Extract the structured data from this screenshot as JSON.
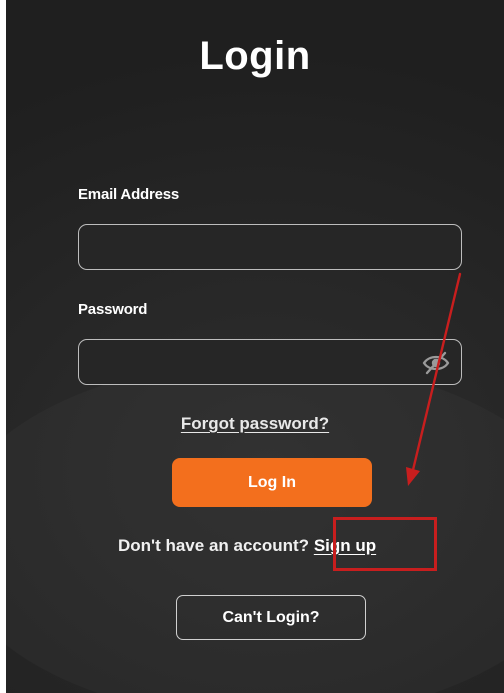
{
  "login_form": {
    "title": "Login",
    "email": {
      "label": "Email Address",
      "value": "",
      "placeholder": ""
    },
    "password": {
      "label": "Password",
      "value": "",
      "placeholder": "",
      "visibility_icon": "eye-slash-icon"
    },
    "forgot_password_link": "Forgot password?",
    "login_button": "Log In",
    "signup_prompt": "Don't have an account?",
    "signup_link": "Sign up",
    "cant_login_button": "Can't Login?"
  },
  "annotation": {
    "type": "red-arrow-and-box",
    "color": "#c81e1e",
    "target": "signup-link"
  },
  "colors": {
    "background": "#262626",
    "accent": "#f36f1d",
    "text": "#ffffff"
  }
}
